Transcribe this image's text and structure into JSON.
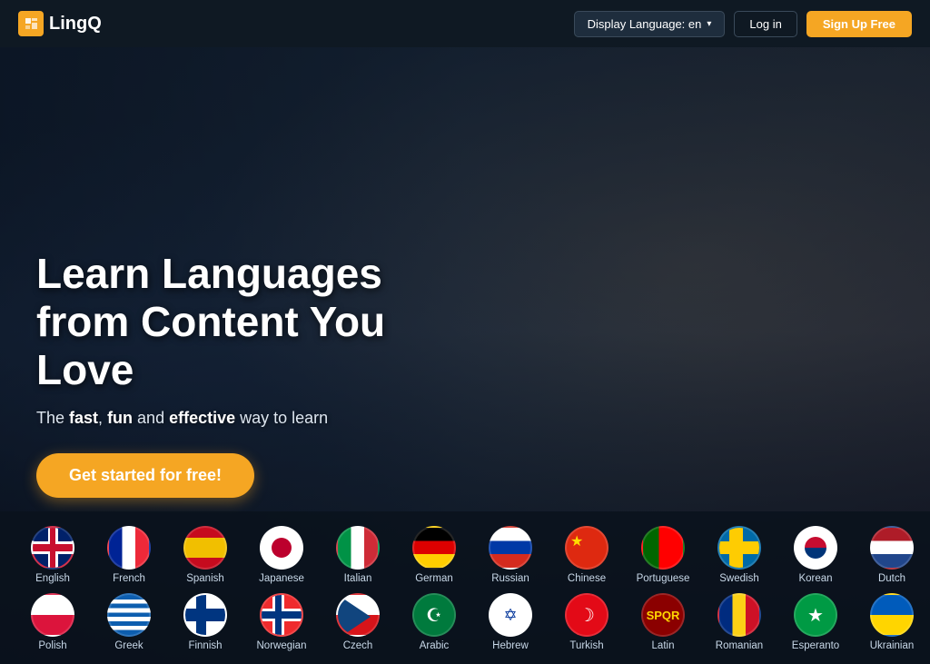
{
  "header": {
    "logo_text": "LingQ",
    "display_language_btn": "Display Language: en",
    "login_btn": "Log in",
    "signup_btn": "Sign Up Free"
  },
  "hero": {
    "title": "Learn Languages from Content You Love",
    "subtitle_prefix": "The ",
    "subtitle_fast": "fast",
    "subtitle_mid": ", ",
    "subtitle_fun": "fun",
    "subtitle_and": " and ",
    "subtitle_effective": "effective",
    "subtitle_suffix": " way to learn",
    "cta_btn": "Get started for free!"
  },
  "languages": {
    "row1": [
      {
        "name": "English",
        "flag_class": "flag-english",
        "type": "uk"
      },
      {
        "name": "French",
        "flag_class": "flag-french",
        "type": "simple"
      },
      {
        "name": "Spanish",
        "flag_class": "flag-spanish",
        "type": "simple"
      },
      {
        "name": "Japanese",
        "flag_class": "flag-japanese",
        "type": "japan"
      },
      {
        "name": "Italian",
        "flag_class": "flag-italian",
        "type": "simple"
      },
      {
        "name": "German",
        "flag_class": "flag-german",
        "type": "simple"
      },
      {
        "name": "Russian",
        "flag_class": "flag-russian",
        "type": "simple"
      },
      {
        "name": "Chinese",
        "flag_class": "flag-chinese",
        "type": "china"
      },
      {
        "name": "Portuguese",
        "flag_class": "flag-portuguese",
        "type": "simple"
      },
      {
        "name": "Swedish",
        "flag_class": "flag-swedish",
        "type": "cross"
      },
      {
        "name": "Korean",
        "flag_class": "flag-korean",
        "type": "korea"
      },
      {
        "name": "Dutch",
        "flag_class": "flag-dutch",
        "type": "simple"
      }
    ],
    "row2": [
      {
        "name": "Polish",
        "flag_class": "flag-polish",
        "type": "simple"
      },
      {
        "name": "Greek",
        "flag_class": "flag-greek",
        "type": "simple"
      },
      {
        "name": "Finnish",
        "flag_class": "flag-finnish",
        "type": "finland"
      },
      {
        "name": "Norwegian",
        "flag_class": "flag-norwegian",
        "type": "norway"
      },
      {
        "name": "Czech",
        "flag_class": "flag-czech",
        "type": "czech"
      },
      {
        "name": "Arabic",
        "flag_class": "flag-arabic",
        "type": "arabic"
      },
      {
        "name": "Hebrew",
        "flag_class": "flag-hebrew",
        "type": "hebrew"
      },
      {
        "name": "Turkish",
        "flag_class": "flag-turkish",
        "type": "turkish"
      },
      {
        "name": "Latin",
        "flag_class": "flag-latin",
        "type": "latin"
      },
      {
        "name": "Romanian",
        "flag_class": "flag-romanian",
        "type": "simple"
      },
      {
        "name": "Esperanto",
        "flag_class": "flag-esperanto",
        "type": "esperanto"
      },
      {
        "name": "Ukrainian",
        "flag_class": "flag-ukrainian",
        "type": "simple"
      }
    ]
  }
}
